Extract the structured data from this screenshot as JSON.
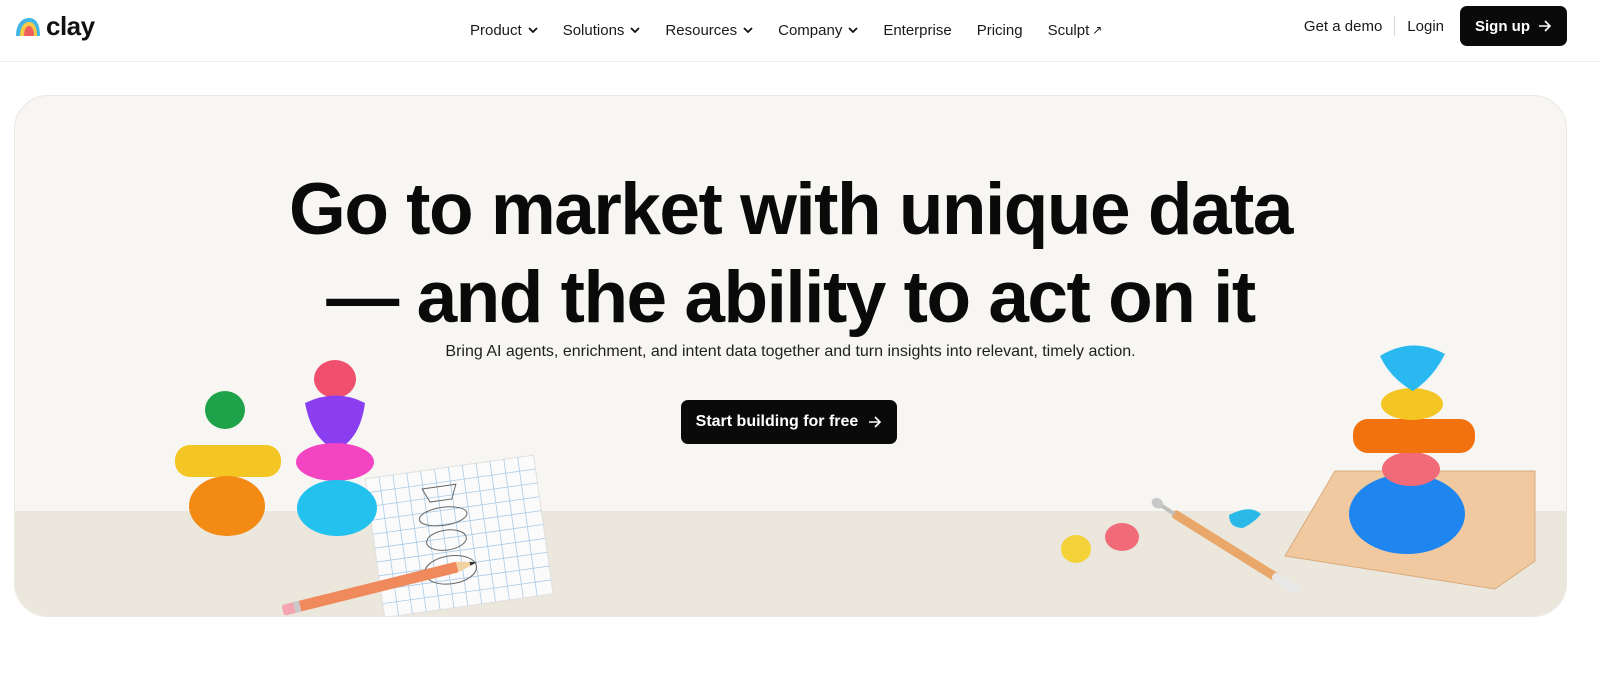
{
  "brand": {
    "name": "clay"
  },
  "nav": {
    "items": [
      {
        "label": "Product",
        "dropdown": true
      },
      {
        "label": "Solutions",
        "dropdown": true
      },
      {
        "label": "Resources",
        "dropdown": true
      },
      {
        "label": "Company",
        "dropdown": true
      },
      {
        "label": "Enterprise",
        "dropdown": false
      },
      {
        "label": "Pricing",
        "dropdown": false
      },
      {
        "label": "Sculpt",
        "external": true
      }
    ],
    "external_glyph": "↗",
    "demo_label": "Get a demo",
    "login_label": "Login",
    "signup_label": "Sign up"
  },
  "hero": {
    "headline_line1": "Go to market with unique data",
    "headline_line2": "— and the ability to act on it",
    "subline": "Bring AI agents, enrichment, and intent data together and turn insights into relevant, timely action.",
    "cta_label": "Start building for free"
  },
  "icons": {
    "chevron": "chevron-down-icon",
    "arrow": "arrow-right-icon",
    "external": "external-link-icon"
  },
  "colors": {
    "accent": "#0a0a0a",
    "hero_bg": "#f7f6f3",
    "floor": "#ebe7dd"
  }
}
